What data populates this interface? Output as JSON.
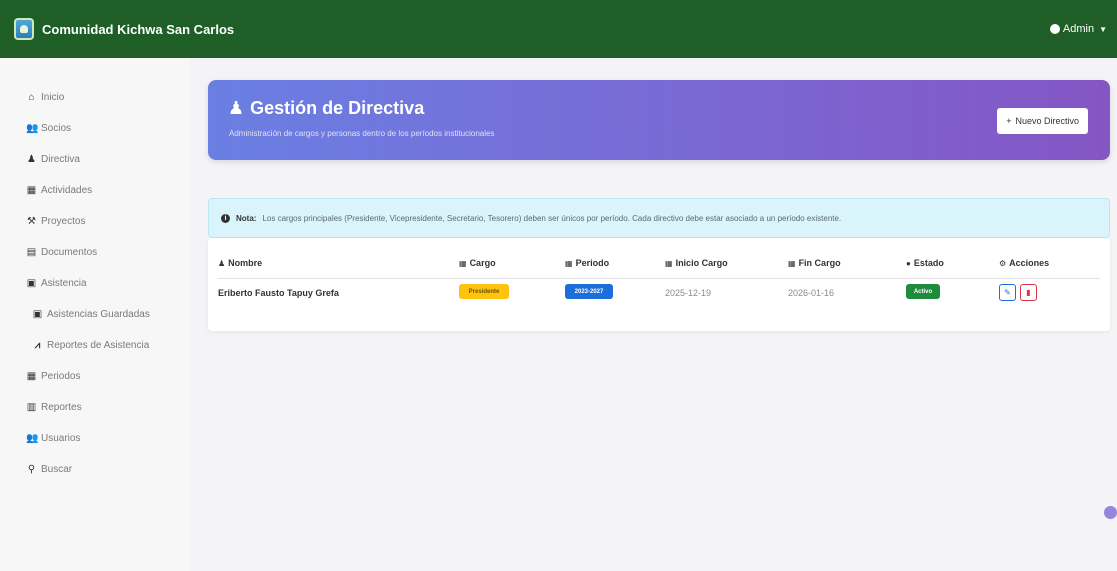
{
  "navbar": {
    "brand_title": "Comunidad Kichwa San Carlos",
    "admin_label": "Admin",
    "bg_color": "#1f5e27"
  },
  "sidebar": {
    "items": [
      {
        "label": "Inicio",
        "icon": "home-icon"
      },
      {
        "label": "Socios",
        "icon": "users-icon"
      },
      {
        "label": "Directiva",
        "icon": "user-tie-icon"
      },
      {
        "label": "Actividades",
        "icon": "calendar-icon"
      },
      {
        "label": "Proyectos",
        "icon": "project-icon"
      },
      {
        "label": "Documentos",
        "icon": "file-icon"
      },
      {
        "label": "Asistencia",
        "icon": "clipboard-icon"
      },
      {
        "label": "Asistencias Guardadas",
        "icon": "saved-icon"
      },
      {
        "label": "Reportes de Asistencia",
        "icon": "chart-line-icon"
      },
      {
        "label": "Periodos",
        "icon": "calendar-icon"
      },
      {
        "label": "Reportes",
        "icon": "chart-bar-icon"
      },
      {
        "label": "Usuarios",
        "icon": "users-cog-icon"
      },
      {
        "label": "Buscar",
        "icon": "search-icon"
      }
    ]
  },
  "hero": {
    "title": "Gestión de Directiva",
    "subtitle": "Administración de cargos y personas dentro de los períodos institucionales",
    "new_button": "Nuevo Directivo",
    "gradient_start": "#6a7fe2",
    "gradient_end": "#8456c4"
  },
  "alert": {
    "strong": "Nota:",
    "text": "Los cargos principales (Presidente, Vicepresidente, Secretario, Tesorero) deben ser únicos por período. Cada directivo debe estar asociado a un período existente."
  },
  "table": {
    "headers": [
      "Nombre",
      "Cargo",
      "Periodo",
      "Inicio Cargo",
      "Fin Cargo",
      "Estado",
      "Acciones"
    ],
    "rows": [
      {
        "nombre": "Eriberto Fausto Tapuy Grefa",
        "cargo": "Presidente",
        "periodo": "2023-2027",
        "inicio": "2025-12-19",
        "fin": "2026-01-16",
        "estado": "Activo"
      }
    ]
  }
}
